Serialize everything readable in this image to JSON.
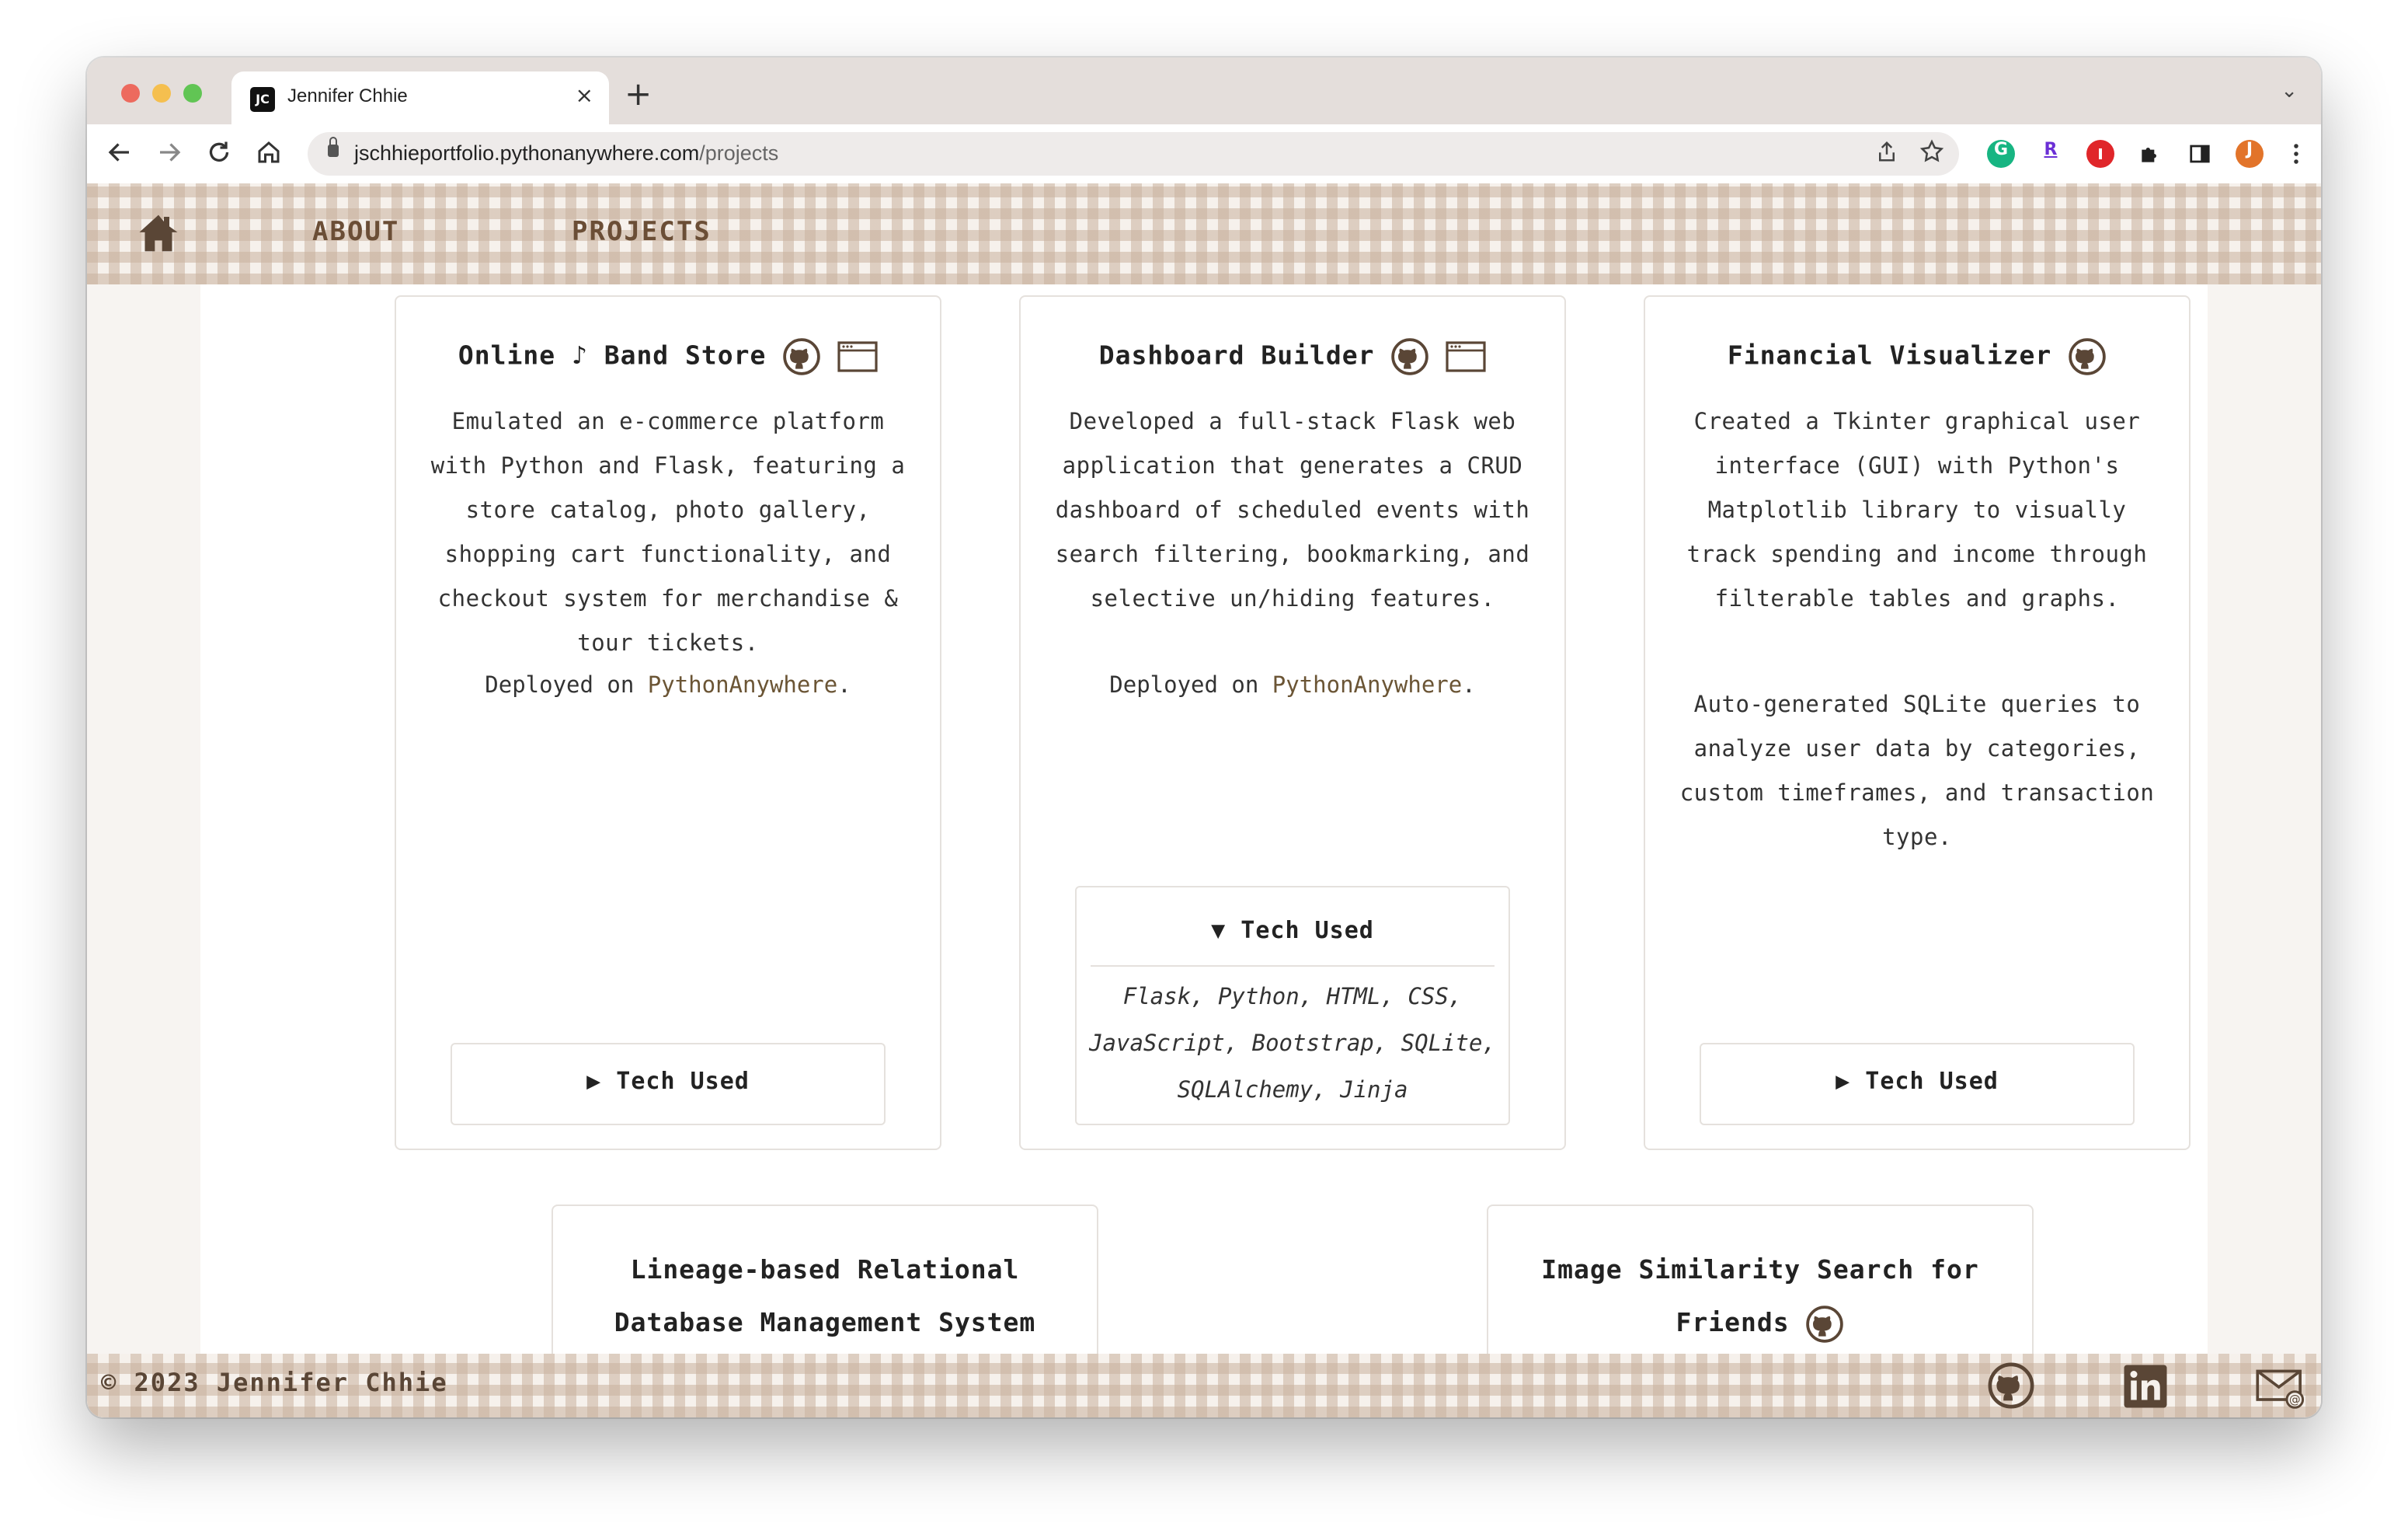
{
  "browser": {
    "tab_title": "Jennifer Chhie",
    "favicon_text": "JC",
    "close_glyph": "×",
    "new_tab_glyph": "+",
    "tab_menu_glyph": "⌄",
    "url_host": "jschhieportfolio.pythonanywhere.com",
    "url_path": "/projects",
    "nav_icons": [
      "back-icon",
      "forward-icon",
      "reload-icon",
      "home-icon"
    ],
    "extensions": [
      "grammarly-icon",
      "r-extension-icon",
      "adblock-icon",
      "puzzle-icon",
      "sidepanel-icon",
      "profile-avatar",
      "menu-icon"
    ],
    "profile_initial": "J",
    "extension_r_label": "R",
    "extension_g_label": "G",
    "accent_colors": {
      "close": "#ed6a5e",
      "minimize": "#f5bf4f",
      "maximize": "#61c554",
      "profile": "#e2742a"
    }
  },
  "nav": {
    "about_label": "ABOUT",
    "projects_label": "PROJECTS"
  },
  "projects": [
    {
      "title_part1": "Online",
      "title_note": "♪",
      "title_part2": "Band Store",
      "description": "Emulated an e-commerce platform with Python and Flask, featuring a store catalog, photo gallery, shopping cart functionality, and checkout system for merchandise & tour tickets.",
      "deploy_prefix": "Deployed on ",
      "deploy_link": "PythonAnywhere",
      "deploy_suffix": ".",
      "tech_label": "Tech Used",
      "tech_toggle": "▶"
    },
    {
      "title": "Dashboard Builder",
      "description": "Developed a full-stack Flask web application that generates a CRUD dashboard of scheduled events with search filtering, bookmarking, and selective un/hiding features.",
      "deploy_prefix": "Deployed on ",
      "deploy_link": "PythonAnywhere",
      "deploy_suffix": ".",
      "tech_label": "Tech Used",
      "tech_toggle": "▼",
      "tech_list": "Flask, Python, HTML, CSS, JavaScript, Bootstrap, SQLite, SQLAlchemy, Jinja"
    },
    {
      "title": "Financial Visualizer",
      "description": "Created a Tkinter graphical user interface (GUI) with Python's Matplotlib library to visually track spending and income through filterable tables and graphs.",
      "description2": "Auto-generated SQLite queries to analyze user data by categories, custom timeframes, and transaction type.",
      "tech_label": "Tech Used",
      "tech_toggle": "▶"
    },
    {
      "title": "Lineage-based Relational Database Management System"
    },
    {
      "title": "Image Similarity Search for Friends"
    }
  ],
  "footer": {
    "copyright": "© 2023 Jennifer Chhie",
    "social_icons": [
      "github-icon",
      "linkedin-icon",
      "email-icon"
    ]
  },
  "colors": {
    "brand_brown": "#6b4e36",
    "gingham": "#c9b29e",
    "link": "#6b5535"
  }
}
